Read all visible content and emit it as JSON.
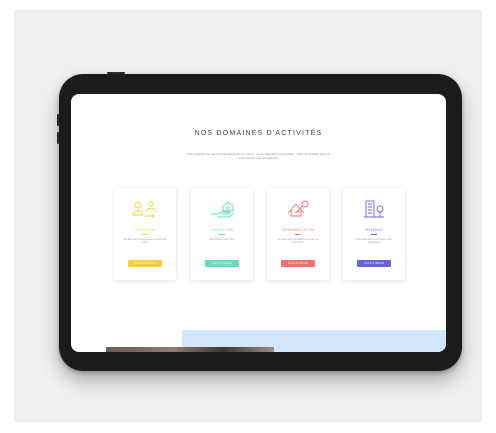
{
  "page": {
    "title": "NOS DOMAINES D'ACTIVITÉS",
    "intro": "Pour satisfaire au mieux la demande de nos clients, nous n'abordons l'immobilier : dans sa globalité pour en comprendre tous ses aspects."
  },
  "colors": {
    "gestion": "#f5cf3f",
    "location": "#5ee0be",
    "transaction": "#f4706e",
    "syndic": "#6a63dd"
  },
  "cards": [
    {
      "name": "GESTION",
      "icon": "people-exchange-icon",
      "desc": "De 160 nous gérons le bien confié à nos soins.",
      "button": "PLUS D'INFOS"
    },
    {
      "name": "LOCATION",
      "icon": "hand-house-icon",
      "desc": "Nous louons votre bien.",
      "button": "PLUS D'INFOS"
    },
    {
      "name": "TRANSACTION",
      "icon": "house-key-icon",
      "desc": "Au mieux des transactions la vente est notre force.",
      "button": "PLUS D'INFOS"
    },
    {
      "name": "SYNDIC",
      "icon": "building-tree-icon",
      "desc": "Nous vous aidons pour gérer votre copropriété.",
      "button": "PLUS D'INFOS"
    }
  ]
}
